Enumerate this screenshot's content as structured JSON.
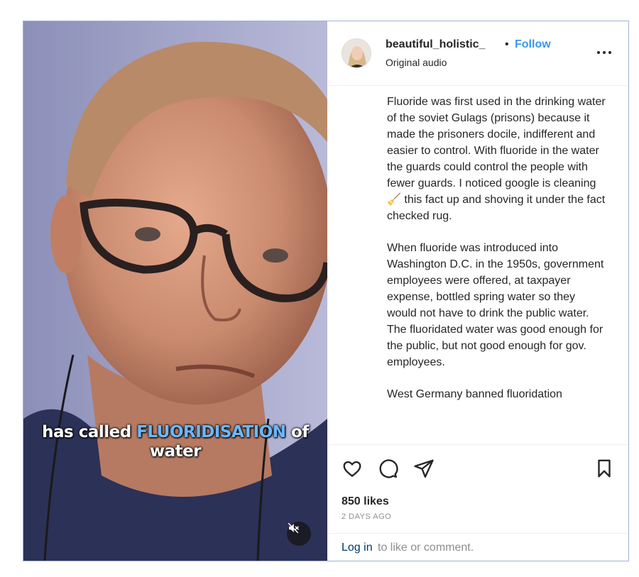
{
  "post": {
    "username": "beautiful_holistic_",
    "separator": "•",
    "follow_label": "Follow",
    "audio_label": "Original audio",
    "caption_paragraphs": [
      "Fluoride was first used in the drinking water of the soviet Gulags (prisons) because it made the prisoners docile, indifferent and easier to control. With fluoride in the water the guards could control the people with fewer guards. I noticed google is cleaning 🧹 this fact up and shoving it under the fact checked rug.",
      "When fluoride was introduced into Washington D.C. in the 1950s, government employees were offered, at taxpayer expense, bottled spring water so they would not have to drink the public water. The fluoridated water was good enough for the public, but not good enough for gov. employees.",
      "West Germany banned fluoridation"
    ],
    "likes": "850 likes",
    "date": "2 DAYS AGO",
    "login_link": "Log in",
    "login_rest": "to like or comment."
  },
  "video": {
    "subtitle_part1": "has called ",
    "subtitle_highlight": "FLUORIDISATION",
    "subtitle_part2": " of",
    "subtitle_line2": "water",
    "muted": true
  },
  "icons": {
    "like": "heart-icon",
    "comment": "comment-icon",
    "share": "share-icon",
    "save": "bookmark-icon",
    "more": "more-options-icon",
    "mute": "muted-speaker-icon"
  },
  "colors": {
    "follow": "#3897f0",
    "subtitle_highlight": "#6bb8ff",
    "login_link": "#00376b"
  }
}
